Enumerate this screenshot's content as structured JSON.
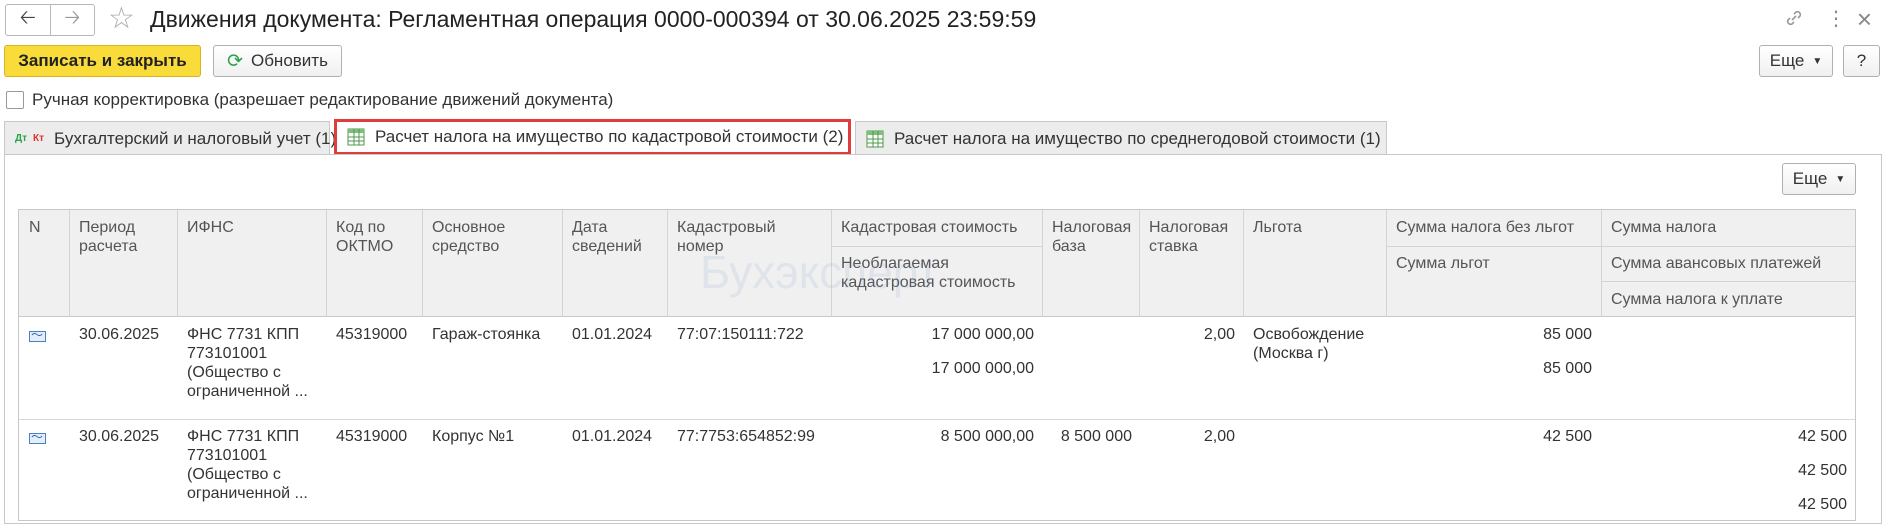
{
  "window": {
    "title": "Движения документа: Регламентная операция 0000-000394 от 30.06.2025 23:59:59",
    "back_icon": "arrow-left-icon",
    "forward_icon": "arrow-right-icon",
    "link_icon": "link-icon",
    "menu_icon": "more-vertical-icon",
    "close_icon": "close-icon"
  },
  "toolbar": {
    "save_close_label": "Записать и закрыть",
    "refresh_label": "Обновить",
    "more_label": "Еще",
    "help_label": "?"
  },
  "manual_edit": {
    "label": "Ручная корректировка (разрешает редактирование движений документа)",
    "checked": false
  },
  "tabs": [
    {
      "label": "Бухгалтерский и налоговый учет (1)",
      "active": false,
      "icon_top": "Дт",
      "icon_bottom": "Кт"
    },
    {
      "label": "Расчет налога на имущество по кадастровой стоимости (2)",
      "active": true
    },
    {
      "label": "Расчет налога на имущество по среднегодовой стоимости (1)",
      "active": false
    }
  ],
  "panel": {
    "more_label": "Еще"
  },
  "table": {
    "headers": {
      "n": "N",
      "period": "Период расчета",
      "ifns": "ИФНС",
      "oktmo": "Код по ОКТМО",
      "asset": "Основное средство",
      "date": "Дата сведений",
      "cadastral_number": "Кадастровый номер",
      "cadastral_value": "Кадастровая стоимость",
      "nontaxable_value": "Необлагаемая кадастровая стоимость",
      "tax_base": "Налоговая база",
      "tax_rate": "Налоговая ставка",
      "benefit": "Льгота",
      "tax_without_benefits": "Сумма налога без льгот",
      "benefits_sum": "Сумма льгот",
      "tax_sum": "Сумма налога",
      "advance_payments": "Сумма авансовых платежей",
      "tax_payable": "Сумма налога к уплате"
    },
    "rows": [
      {
        "period": "30.06.2025",
        "ifns_line1": "ФНС 7731 КПП",
        "ifns_line2": "773101001",
        "ifns_line3": "(Общество с",
        "ifns_line4": "ограниченной ...",
        "oktmo": "45319000",
        "asset": "Гараж-стоянка",
        "date": "01.01.2024",
        "cadastral_number": "77:07:150111:722",
        "cadastral_value": "17 000 000,00",
        "nontaxable_value": "17 000 000,00",
        "tax_base": "",
        "tax_rate": "2,00",
        "benefit_line1": "Освобождение",
        "benefit_line2": "(Москва г)",
        "tax_without_benefits": "85 000",
        "benefits_sum": "85 000",
        "tax_sum": "",
        "advance_payments": "",
        "tax_payable": ""
      },
      {
        "period": "30.06.2025",
        "ifns_line1": "ФНС 7731 КПП",
        "ifns_line2": "773101001",
        "ifns_line3": "(Общество с",
        "ifns_line4": "ограниченной ...",
        "oktmo": "45319000",
        "asset": "Корпус №1",
        "date": "01.01.2024",
        "cadastral_number": "77:7753:654852:99",
        "cadastral_value": "8 500 000,00",
        "nontaxable_value": "",
        "tax_base": "8 500 000",
        "tax_rate": "2,00",
        "benefit_line1": "",
        "benefit_line2": "",
        "tax_without_benefits": "42 500",
        "benefits_sum": "",
        "tax_sum": "42 500",
        "advance_payments": "42 500",
        "tax_payable": "42 500"
      }
    ]
  },
  "watermark": "Бухэксперт"
}
